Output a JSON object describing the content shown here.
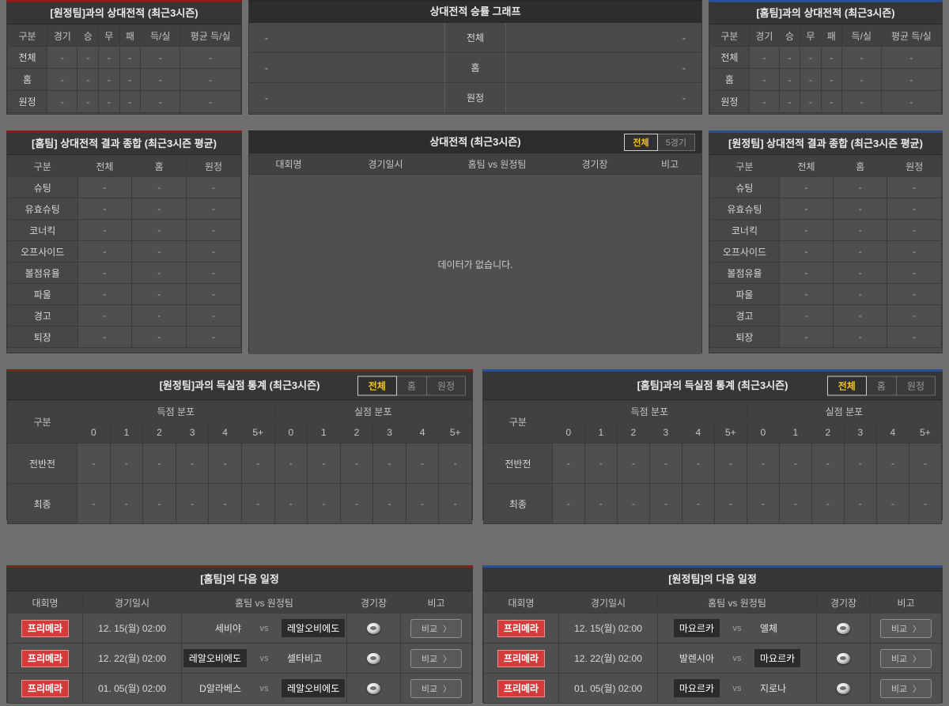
{
  "colors": {
    "home_accent": "#8f1b1b",
    "away_accent": "#2c4f9a",
    "active_tab_text": "#f2c31d",
    "league_badge_bg": "#d43c3c"
  },
  "record_vs_away": {
    "title": "[원정팀]과의 상대전적 (최근3시즌)",
    "columns": [
      "구분",
      "경기",
      "승",
      "무",
      "패",
      "득/실",
      "평균 득/실"
    ],
    "rows": [
      {
        "label": "전체",
        "values": [
          "-",
          "-",
          "-",
          "-",
          "-",
          "-"
        ]
      },
      {
        "label": "홈",
        "values": [
          "-",
          "-",
          "-",
          "-",
          "-",
          "-"
        ]
      },
      {
        "label": "원정",
        "values": [
          "-",
          "-",
          "-",
          "-",
          "-",
          "-"
        ]
      }
    ]
  },
  "winrate_graph": {
    "title": "상대전적 승률 그래프",
    "rows": [
      {
        "left_value": "-",
        "label": "전체",
        "right_value": "-"
      },
      {
        "left_value": "-",
        "label": "홈",
        "right_value": "-"
      },
      {
        "left_value": "-",
        "label": "원정",
        "right_value": "-"
      }
    ]
  },
  "record_vs_home": {
    "title": "[홈팀]과의 상대전적 (최근3시즌)",
    "columns": [
      "구분",
      "경기",
      "승",
      "무",
      "패",
      "득/실",
      "평균 득/실"
    ],
    "rows": [
      {
        "label": "전체",
        "values": [
          "-",
          "-",
          "-",
          "-",
          "-",
          "-"
        ]
      },
      {
        "label": "홈",
        "values": [
          "-",
          "-",
          "-",
          "-",
          "-",
          "-"
        ]
      },
      {
        "label": "원정",
        "values": [
          "-",
          "-",
          "-",
          "-",
          "-",
          "-"
        ]
      }
    ]
  },
  "summary_home": {
    "title": "[홈팀] 상대전적 결과 종합 (최근3시즌 평균)",
    "columns": [
      "구분",
      "전체",
      "홈",
      "원정"
    ],
    "rows": [
      {
        "label": "슈팅",
        "values": [
          "-",
          "-",
          "-"
        ]
      },
      {
        "label": "유효슈팅",
        "values": [
          "-",
          "-",
          "-"
        ]
      },
      {
        "label": "코너킥",
        "values": [
          "-",
          "-",
          "-"
        ]
      },
      {
        "label": "오프사이드",
        "values": [
          "-",
          "-",
          "-"
        ]
      },
      {
        "label": "볼점유율",
        "values": [
          "-",
          "-",
          "-"
        ]
      },
      {
        "label": "파울",
        "values": [
          "-",
          "-",
          "-"
        ]
      },
      {
        "label": "경고",
        "values": [
          "-",
          "-",
          "-"
        ]
      },
      {
        "label": "퇴장",
        "values": [
          "-",
          "-",
          "-"
        ]
      }
    ]
  },
  "history": {
    "title": "상대전적 (최근3시즌)",
    "tabs": [
      {
        "label": "전체",
        "active": true
      },
      {
        "label": "5경기",
        "active": false
      }
    ],
    "columns": {
      "league": "대회명",
      "datetime": "경기일시",
      "match": "홈팀  vs  원정팀",
      "stadium": "경기장",
      "remark": "비고"
    },
    "empty_message": "데이터가 없습니다."
  },
  "summary_away": {
    "title": "[원정팀] 상대전적 결과 종합 (최근3시즌 평균)",
    "columns": [
      "구분",
      "전체",
      "홈",
      "원정"
    ],
    "rows": [
      {
        "label": "슈팅",
        "values": [
          "-",
          "-",
          "-"
        ]
      },
      {
        "label": "유효슈팅",
        "values": [
          "-",
          "-",
          "-"
        ]
      },
      {
        "label": "코너킥",
        "values": [
          "-",
          "-",
          "-"
        ]
      },
      {
        "label": "오프사이드",
        "values": [
          "-",
          "-",
          "-"
        ]
      },
      {
        "label": "볼점유율",
        "values": [
          "-",
          "-",
          "-"
        ]
      },
      {
        "label": "파울",
        "values": [
          "-",
          "-",
          "-"
        ]
      },
      {
        "label": "경고",
        "values": [
          "-",
          "-",
          "-"
        ]
      },
      {
        "label": "퇴장",
        "values": [
          "-",
          "-",
          "-"
        ]
      }
    ]
  },
  "goals_vs_away": {
    "title": "[원정팀]과의 득실점 통계 (최근3시즌)",
    "tabs": [
      {
        "label": "전체",
        "active": true
      },
      {
        "label": "홈",
        "active": false
      },
      {
        "label": "원정",
        "active": false
      }
    ],
    "corner_label": "구분",
    "group_headers": [
      "득점 분포",
      "실점 분포"
    ],
    "score_columns": [
      "0",
      "1",
      "2",
      "3",
      "4",
      "5+"
    ],
    "rows": [
      {
        "label": "전반전",
        "scored": [
          "-",
          "-",
          "-",
          "-",
          "-",
          "-"
        ],
        "conceded": [
          "-",
          "-",
          "-",
          "-",
          "-",
          "-"
        ]
      },
      {
        "label": "최종",
        "scored": [
          "-",
          "-",
          "-",
          "-",
          "-",
          "-"
        ],
        "conceded": [
          "-",
          "-",
          "-",
          "-",
          "-",
          "-"
        ]
      }
    ]
  },
  "goals_vs_home": {
    "title": "[홈팀]과의 득실점 통계 (최근3시즌)",
    "tabs": [
      {
        "label": "전체",
        "active": true
      },
      {
        "label": "홈",
        "active": false
      },
      {
        "label": "원정",
        "active": false
      }
    ],
    "corner_label": "구분",
    "group_headers": [
      "득점 분포",
      "실점 분포"
    ],
    "score_columns": [
      "0",
      "1",
      "2",
      "3",
      "4",
      "5+"
    ],
    "rows": [
      {
        "label": "전반전",
        "scored": [
          "-",
          "-",
          "-",
          "-",
          "-",
          "-"
        ],
        "conceded": [
          "-",
          "-",
          "-",
          "-",
          "-",
          "-"
        ]
      },
      {
        "label": "최종",
        "scored": [
          "-",
          "-",
          "-",
          "-",
          "-",
          "-"
        ],
        "conceded": [
          "-",
          "-",
          "-",
          "-",
          "-",
          "-"
        ]
      }
    ]
  },
  "schedule_home": {
    "title": "[홈팀]의 다음 일정",
    "columns": {
      "league": "대회명",
      "datetime": "경기일시",
      "match": "홈팀  vs  원정팀",
      "stadium": "경기장",
      "remark": "비고"
    },
    "vs_label": "vs",
    "compare_label": "비교",
    "compare_arrow": "〉",
    "rows": [
      {
        "league": "프리메라",
        "datetime": "12. 15(월) 02:00",
        "home": "세비야",
        "away": "레알오비에도",
        "home_hl": false,
        "away_hl": true
      },
      {
        "league": "프리메라",
        "datetime": "12. 22(월) 02:00",
        "home": "레알오비에도",
        "away": "셀타비고",
        "home_hl": true,
        "away_hl": false
      },
      {
        "league": "프리메라",
        "datetime": "01. 05(월) 02:00",
        "home": "D알라베스",
        "away": "레알오비에도",
        "home_hl": false,
        "away_hl": true
      }
    ]
  },
  "schedule_away": {
    "title": "[원정팀]의 다음 일정",
    "columns": {
      "league": "대회명",
      "datetime": "경기일시",
      "match": "홈팀  vs  원정팀",
      "stadium": "경기장",
      "remark": "비고"
    },
    "vs_label": "vs",
    "compare_label": "비교",
    "compare_arrow": "〉",
    "rows": [
      {
        "league": "프리메라",
        "datetime": "12. 15(월) 02:00",
        "home": "마요르카",
        "away": "엘체",
        "home_hl": true,
        "away_hl": false
      },
      {
        "league": "프리메라",
        "datetime": "12. 22(월) 02:00",
        "home": "발렌시아",
        "away": "마요르카",
        "home_hl": false,
        "away_hl": true
      },
      {
        "league": "프리메라",
        "datetime": "01. 05(월) 02:00",
        "home": "마요르카",
        "away": "지로나",
        "home_hl": true,
        "away_hl": false
      }
    ]
  }
}
